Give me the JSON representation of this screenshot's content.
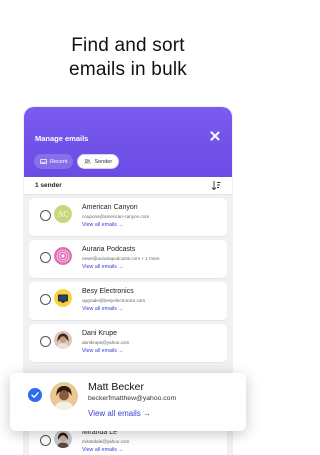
{
  "headline": {
    "line1": "Find and sort",
    "line2": "emails in bulk"
  },
  "colors": {
    "header": "#6d50e8",
    "link": "#3a42d6",
    "check": "#2d6cf0"
  },
  "header": {
    "title": "Manage emails",
    "close_icon": "close-icon"
  },
  "tabs": [
    {
      "label": "Recent",
      "icon": "inbox-icon",
      "active": false
    },
    {
      "label": "Sender",
      "icon": "people-icon",
      "active": true
    }
  ],
  "bar": {
    "count_label": "1 sender",
    "sort_icon": "sort-icon"
  },
  "senders": [
    {
      "name": "American Canyon",
      "email": "coupons@american-canyon.com",
      "link": "View all emails →",
      "selected": false
    },
    {
      "name": "Auraria Podcasts",
      "email": "news@aurariapodcasts.com + 1 more",
      "link": "View all emails →",
      "selected": false
    },
    {
      "name": "Besy Electronics",
      "email": "upgrade@besyelectronics.com",
      "link": "View all emails →",
      "selected": false
    },
    {
      "name": "Dani Krupe",
      "email": "danikrupe@yahoo.com",
      "link": "View all emails →",
      "selected": false
    },
    {
      "name": "Miranda Le",
      "email": "mirandale@yahoo.com",
      "link": "View all emails →",
      "selected": false
    }
  ],
  "featured": {
    "name": "Matt Becker",
    "email": "beckerfmatthew@yahoo.com",
    "link": "View all emails →",
    "selected": true
  }
}
